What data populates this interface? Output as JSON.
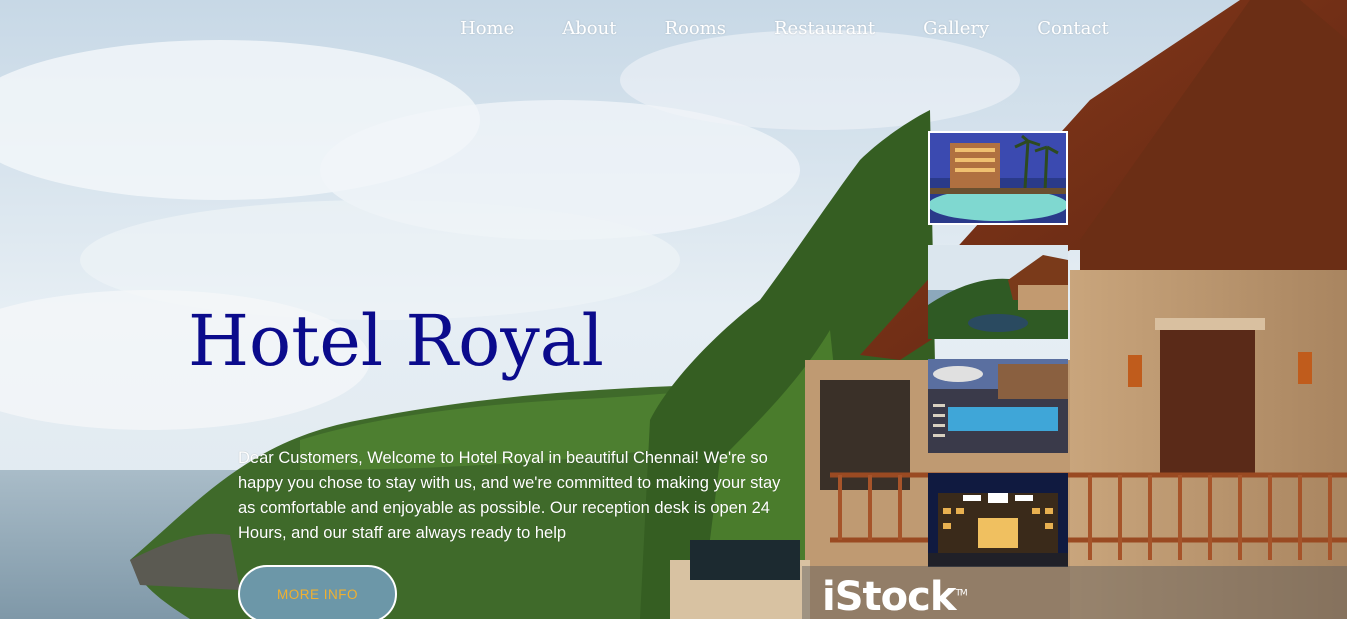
{
  "nav": {
    "items": [
      {
        "label": "Home"
      },
      {
        "label": "About"
      },
      {
        "label": "Rooms"
      },
      {
        "label": "Restaurant"
      },
      {
        "label": "Gallery"
      },
      {
        "label": "Contact"
      }
    ]
  },
  "hero": {
    "title": "Hotel Royal",
    "description": "Dear Customers, Welcome to Hotel Royal in beautiful Chennai! We're so happy you chose to stay with us, and we're committed to making your stay as comfortable and enjoyable as possible. Our reception desk is open 24 Hours, and our staff are always ready to help",
    "button_label": "MORE INFO"
  },
  "gallery": {
    "thumbnails": [
      {
        "icon": "resort-pool-night-image"
      },
      {
        "icon": "coastal-villa-pool-image"
      },
      {
        "icon": "poolside-loungers-image"
      },
      {
        "icon": "hotel-facade-night-image"
      }
    ]
  },
  "watermark": {
    "text": "iStock",
    "tm": "TM"
  },
  "colors": {
    "title": "#0b0b8c",
    "button_bg": "#6c97a8",
    "button_text": "#f0b030",
    "nav_text": "#ffffff"
  }
}
